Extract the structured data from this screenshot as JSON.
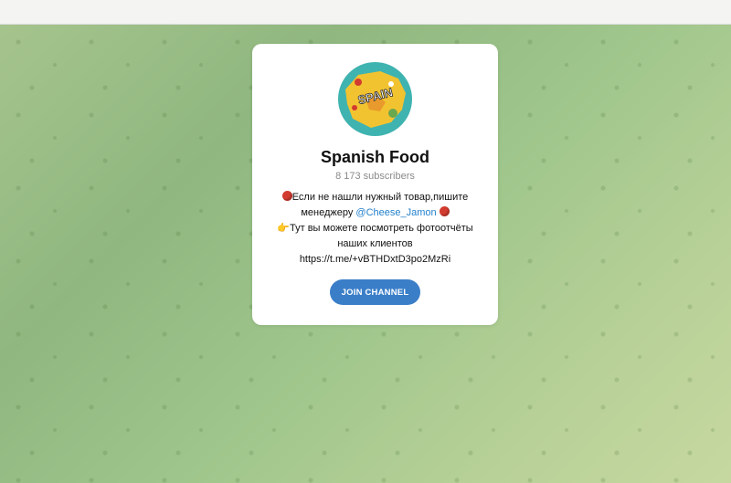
{
  "channel": {
    "title": "Spanish Food",
    "subscribers": "8 173 subscribers",
    "avatar_icon": "spain-map-avatar",
    "avatar_text": "SPAIN",
    "description": {
      "line1_icon": "red-circle-icon",
      "line1_text": "Если не нашли нужный товар,пишите",
      "line2_text": "менеджеру",
      "mention": "@Cheese_Jamon",
      "line2_icon": "red-circle-icon",
      "line3_icon": "pointing-hand-icon",
      "line3_text": "Тут вы можете посмотреть фотоотчёты",
      "line4_text": "наших клиентов",
      "link": "https://t.me/+vBTHDxtD3po2MzRi"
    },
    "join_label": "JOIN CHANNEL"
  },
  "colors": {
    "accent": "#3a7ec8",
    "mention": "#2481cc",
    "background": "#9fc68c"
  }
}
